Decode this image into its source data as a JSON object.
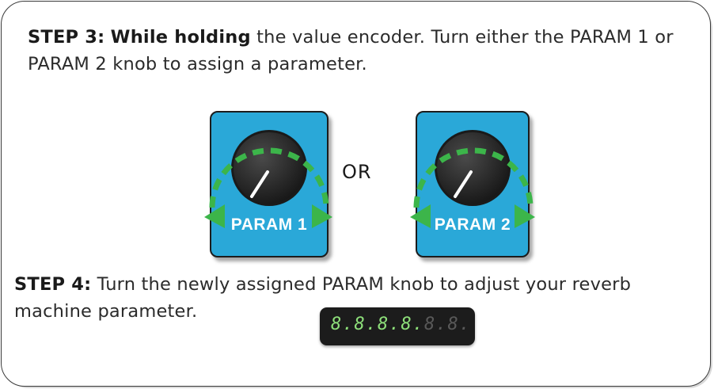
{
  "step3": {
    "label": "STEP 3:",
    "highlight": "While holding",
    "text": " the value encoder. Turn either the PARAM 1 or PARAM 2 knob to assign a parameter."
  },
  "knobs": [
    {
      "label": "PARAM 1"
    },
    {
      "label": "PARAM 2"
    }
  ],
  "or_label": "OR",
  "step4": {
    "label": "STEP 4:",
    "text": " Turn the newly assigned PARAM knob to adjust your reverb machine parameter."
  },
  "display": {
    "lit": "8.8.8.8.",
    "unlit": "8.8."
  },
  "colors": {
    "pedal_blue": "#29a8d8",
    "arc_green": "#3cb54a",
    "knob_black": "#222222"
  }
}
